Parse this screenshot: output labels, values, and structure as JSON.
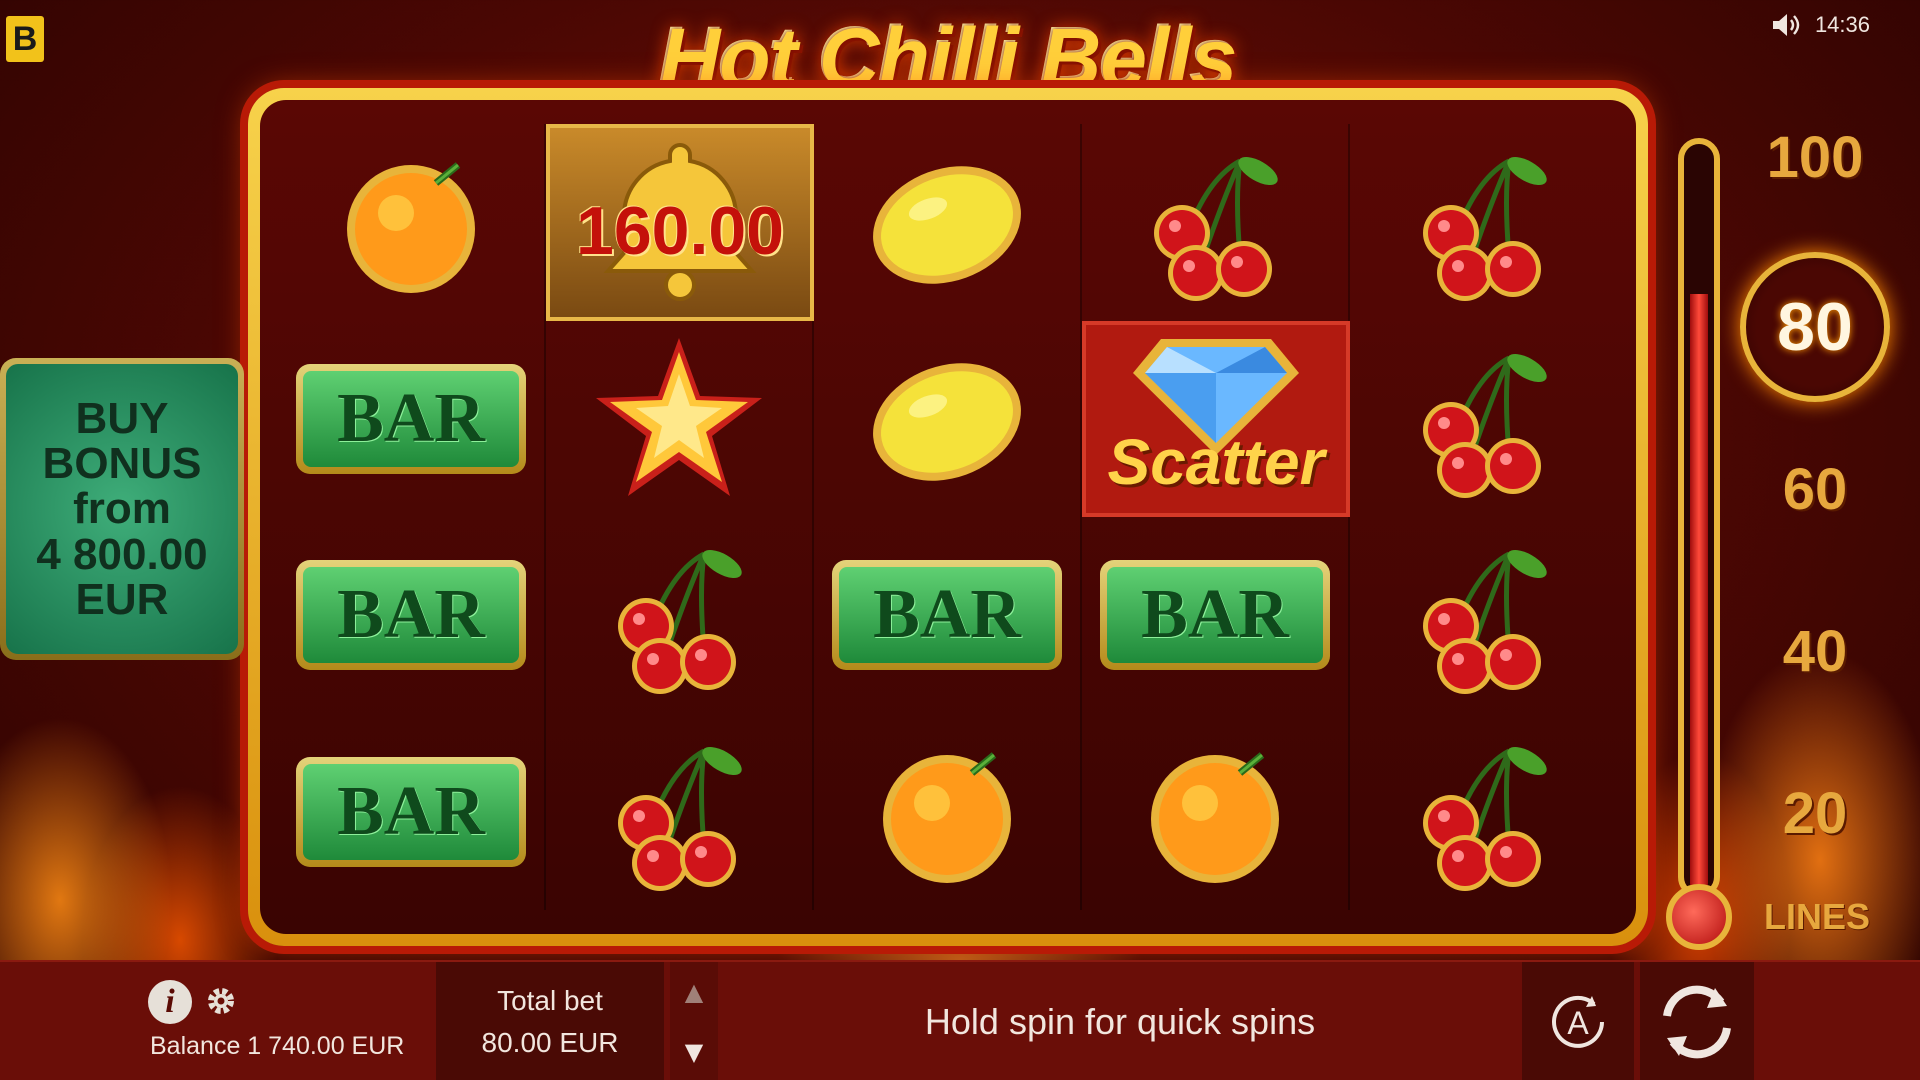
{
  "app": {
    "brand_badge": "B",
    "title": "Hot Chilli Bells"
  },
  "status": {
    "time": "14:36",
    "sound_icon": "speaker-icon"
  },
  "reels": [
    [
      "orange",
      "bell",
      "lemon",
      "cherries",
      "cherries"
    ],
    [
      "bar",
      "star",
      "lemon",
      "scatter",
      "cherries"
    ],
    [
      "bar",
      "cherries",
      "bar",
      "bar",
      "cherries"
    ],
    [
      "bar",
      "cherries",
      "orange",
      "orange",
      "cherries"
    ]
  ],
  "symbols": {
    "bar_label": "BAR",
    "scatter_label": "Scatter"
  },
  "win": {
    "amount": "160.00"
  },
  "buy_bonus": {
    "line1": "BUY",
    "line2": "BONUS",
    "line3": "from",
    "line4": "4 800.00",
    "line5": "EUR"
  },
  "lines": {
    "options": [
      "100",
      "80",
      "60",
      "40",
      "20"
    ],
    "selected": "80",
    "label": "LINES",
    "thermometer_level": 0.8
  },
  "footer": {
    "balance": "Balance 1 740.00 EUR",
    "total_bet_label": "Total bet",
    "total_bet_value": "80.00 EUR",
    "hint": "Hold spin for quick spins",
    "auto_label": "A"
  },
  "colors": {
    "accent_gold": "#e8b43a",
    "bar_green": "#1f8a3a",
    "background": "#4a0703"
  }
}
